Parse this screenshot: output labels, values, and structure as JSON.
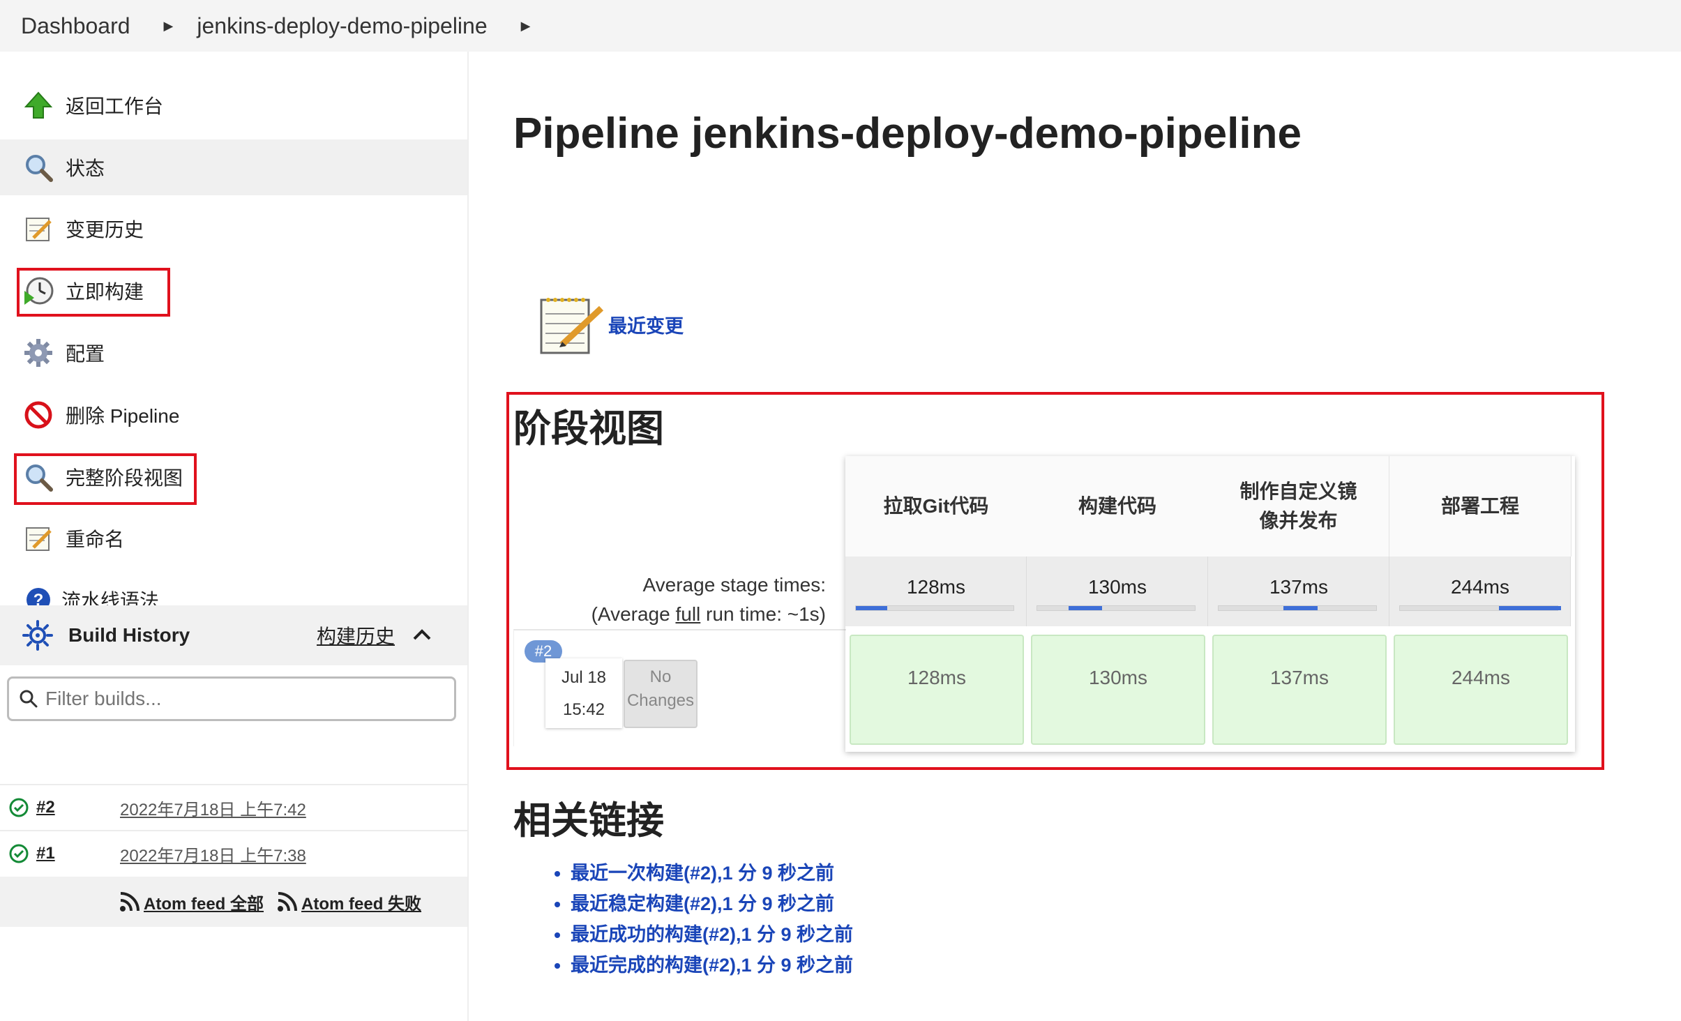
{
  "breadcrumb": {
    "items": [
      "Dashboard",
      "jenkins-deploy-demo-pipeline"
    ]
  },
  "sidebar": {
    "items": [
      {
        "label": "返回工作台",
        "icon": "up-arrow-icon"
      },
      {
        "label": "状态",
        "icon": "search-icon"
      },
      {
        "label": "变更历史",
        "icon": "notepad-icon"
      },
      {
        "label": "立即构建",
        "icon": "clock-play-icon"
      },
      {
        "label": "配置",
        "icon": "gear-icon"
      },
      {
        "label": "删除 Pipeline",
        "icon": "no-entry-icon"
      },
      {
        "label": "完整阶段视图",
        "icon": "search-icon"
      },
      {
        "label": "重命名",
        "icon": "notepad-icon"
      },
      {
        "label": "流水线语法",
        "icon": "help-icon"
      }
    ]
  },
  "build_history": {
    "title": "Build History",
    "title_zh": "构建历史",
    "filter_placeholder": "Filter builds...",
    "builds": [
      {
        "number": "#2",
        "date": "2022年7月18日 上午7:42",
        "status": "success"
      },
      {
        "number": "#1",
        "date": "2022年7月18日 上午7:38",
        "status": "success"
      }
    ],
    "feed_all": "Atom feed 全部",
    "feed_fail": "Atom feed 失败"
  },
  "main": {
    "title": "Pipeline jenkins-deploy-demo-pipeline",
    "recent_changes": "最近变更",
    "stage_view_title": "阶段视图",
    "avg_stage_label": "Average stage times:",
    "avg_full_prefix": "(Average ",
    "avg_full_link": "full",
    "avg_full_suffix": " run time: ~1s)",
    "stages": [
      {
        "name": "拉取Git代码",
        "avg": "128ms",
        "run": "128ms",
        "progress": 0.2
      },
      {
        "name": "构建代码",
        "avg": "130ms",
        "run": "130ms",
        "progress": 0.21
      },
      {
        "name": "制作自定义镜像并发布",
        "avg": "137ms",
        "run": "137ms",
        "progress": 0.22
      },
      {
        "name": "部署工程",
        "avg": "244ms",
        "run": "244ms",
        "progress": 0.39
      }
    ],
    "run": {
      "badge": "#2",
      "date": "Jul 18",
      "time": "15:42",
      "changes": "No Changes"
    },
    "related_links_title": "相关链接",
    "related_links": [
      "最近一次构建(#2),1 分 9 秒之前",
      "最近稳定构建(#2),1 分 9 秒之前",
      "最近成功的构建(#2),1 分 9 秒之前",
      "最近完成的构建(#2),1 分 9 秒之前"
    ]
  },
  "colors": {
    "highlight": "#e0111d",
    "link": "#1a45b8",
    "success_cell": "#e3f9df",
    "progress": "#3e6fd8"
  }
}
